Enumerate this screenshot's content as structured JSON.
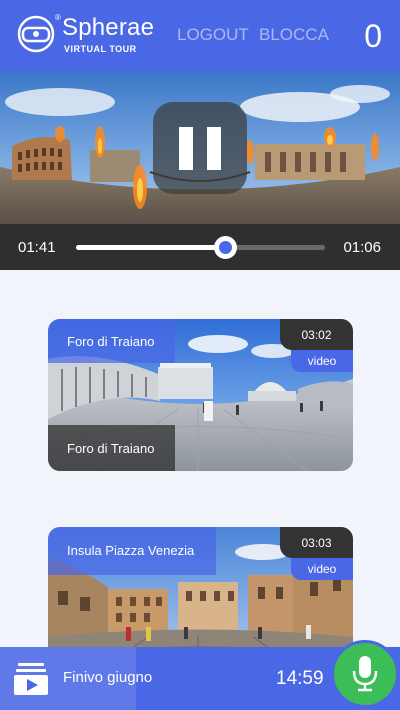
{
  "header": {
    "brand": "Spherae",
    "brand_sub": "VIRTUAL TOUR",
    "brand_mark": "®",
    "logout_label": "LOGOUT",
    "block_label": "BLOCCA",
    "counter": "0"
  },
  "player": {
    "state": "playing",
    "pause_icon": "pause-icon",
    "elapsed": "01:41",
    "remaining": "01:06",
    "progress_fraction": 0.6
  },
  "cards": [
    {
      "title": "Foro di Traiano",
      "subtitle": "Foro di Traiano",
      "duration": "03:02",
      "type": "video"
    },
    {
      "title": "Insula Piazza Venezia",
      "duration": "03:03",
      "type": "video"
    }
  ],
  "footer": {
    "icon": "playlist-video-icon",
    "title": "Finivo giugno",
    "clock": "14:59",
    "mic_icon": "microphone-icon"
  },
  "colors": {
    "primary": "#4a67e6",
    "accent_green": "#3dbd57",
    "dark": "#2f2f30",
    "background": "#f2f4fb"
  }
}
